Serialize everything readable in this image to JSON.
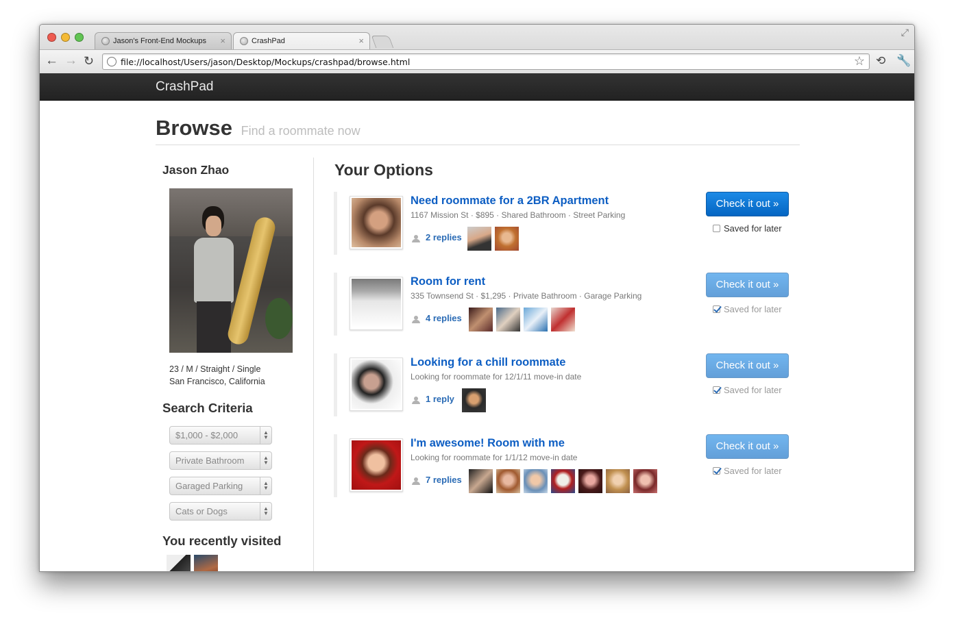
{
  "browser": {
    "tabs": [
      {
        "title": "Jason's Front-End Mockups",
        "close": "×"
      },
      {
        "title": "CrashPad",
        "close": "×"
      }
    ],
    "url": "file://localhost/Users/jason/Desktop/Mockups/crashpad/browse.html",
    "icons": [
      "back-arrow-icon",
      "forward-arrow-icon",
      "reload-icon",
      "star-icon",
      "page-action-icon",
      "wrench-icon"
    ]
  },
  "navbar": {
    "brand": "CrashPad"
  },
  "page": {
    "title": "Browse",
    "subtitle": "Find a roommate now"
  },
  "profile": {
    "name": "Jason Zhao",
    "details": "23 / M / Straight / Single",
    "location": "San Francisco, California"
  },
  "search": {
    "heading": "Search Criteria",
    "selects": [
      "$1,000 - $2,000",
      "Private Bathroom",
      "Garaged Parking",
      "Cats or Dogs"
    ]
  },
  "recent": {
    "heading": "You recently visited",
    "count": 2
  },
  "options_heading": "Your Options",
  "listings": [
    {
      "title": "Need roommate for a 2BR Apartment",
      "meta": "1167 Mission St · $895 · Shared Bathroom · Street Parking",
      "replies": "2 replies",
      "avatar_count": 2,
      "cta": "Check it out »",
      "saved_label": "Saved for later",
      "saved": false
    },
    {
      "title": "Room for rent",
      "meta": "335 Townsend St · $1,295 · Private Bathroom · Garage Parking",
      "replies": "4 replies",
      "avatar_count": 4,
      "cta": "Check it out »",
      "saved_label": "Saved for later",
      "saved": true
    },
    {
      "title": "Looking for a chill roommate",
      "meta": "Looking for roommate for 12/1/11 move-in date",
      "replies": "1 reply",
      "avatar_count": 1,
      "cta": "Check it out »",
      "saved_label": "Saved for later",
      "saved": true
    },
    {
      "title": "I'm awesome! Room with me",
      "meta": "Looking for roommate for 1/1/12 move-in date",
      "replies": "7 replies",
      "avatar_count": 7,
      "cta": "Check it out »",
      "saved_label": "Saved for later",
      "saved": true
    }
  ],
  "colors": {
    "accent": "#0465c2",
    "link": "#0d5ec3",
    "navbar": "#222222"
  }
}
